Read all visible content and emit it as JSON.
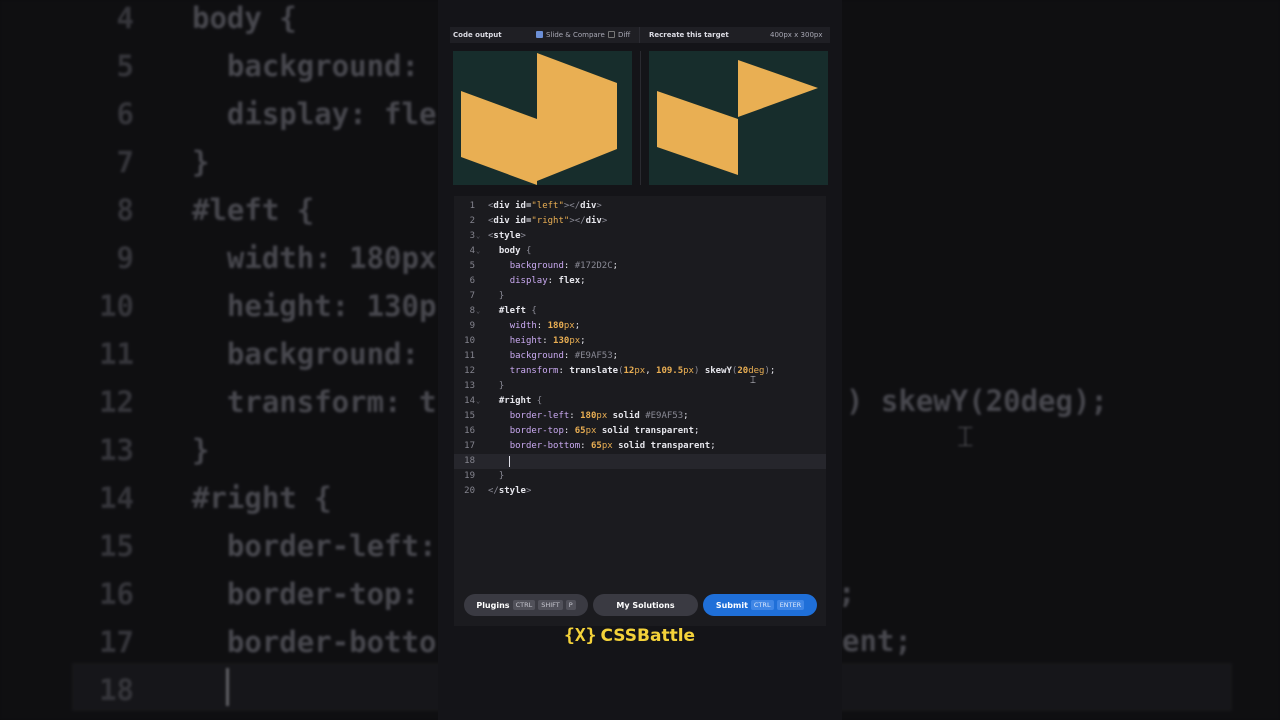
{
  "colors": {
    "accent": "#E9AF53",
    "preview_bg": "#172D2C",
    "submit_blue": "#1f6fd8",
    "logo_yellow": "#f4d23a"
  },
  "toolbar": {
    "code_output": "Code output",
    "slide_compare": "Slide & Compare",
    "slide_compare_checked": true,
    "diff": "Diff",
    "diff_checked": false,
    "recreate": "Recreate this target",
    "size": "400px x 300px"
  },
  "editor": {
    "lines": [
      {
        "n": "1",
        "fold": false,
        "tokens": [
          [
            "br",
            "<"
          ],
          [
            "tag",
            "div"
          ],
          [
            "txt",
            " "
          ],
          [
            "attr",
            "id="
          ],
          [
            "str",
            "\"left\""
          ],
          [
            "br",
            "></"
          ],
          [
            "tag",
            "div"
          ],
          [
            "br",
            ">"
          ]
        ]
      },
      {
        "n": "2",
        "fold": false,
        "tokens": [
          [
            "br",
            "<"
          ],
          [
            "tag",
            "div"
          ],
          [
            "txt",
            " "
          ],
          [
            "attr",
            "id="
          ],
          [
            "str",
            "\"right\""
          ],
          [
            "br",
            "></"
          ],
          [
            "tag",
            "div"
          ],
          [
            "br",
            ">"
          ]
        ]
      },
      {
        "n": "3",
        "fold": true,
        "tokens": [
          [
            "br",
            "<"
          ],
          [
            "tag",
            "style"
          ],
          [
            "br",
            ">"
          ]
        ]
      },
      {
        "n": "4",
        "fold": true,
        "tokens": [
          [
            "txt",
            "  "
          ],
          [
            "sel",
            "body"
          ],
          [
            "txt",
            " "
          ],
          [
            "dim",
            "{"
          ]
        ]
      },
      {
        "n": "5",
        "fold": false,
        "tokens": [
          [
            "txt",
            "    "
          ],
          [
            "prop",
            "background"
          ],
          [
            "txt",
            ": "
          ],
          [
            "dim",
            "#172D2C"
          ],
          [
            "txt",
            ";"
          ]
        ]
      },
      {
        "n": "6",
        "fold": false,
        "tokens": [
          [
            "txt",
            "    "
          ],
          [
            "prop",
            "display"
          ],
          [
            "txt",
            ": "
          ],
          [
            "val",
            "flex"
          ],
          [
            "txt",
            ";"
          ]
        ]
      },
      {
        "n": "7",
        "fold": false,
        "tokens": [
          [
            "txt",
            "  "
          ],
          [
            "dim",
            "}"
          ]
        ]
      },
      {
        "n": "8",
        "fold": true,
        "tokens": [
          [
            "txt",
            "  "
          ],
          [
            "sel",
            "#left"
          ],
          [
            "txt",
            " "
          ],
          [
            "dim",
            "{"
          ]
        ]
      },
      {
        "n": "9",
        "fold": false,
        "tokens": [
          [
            "txt",
            "    "
          ],
          [
            "prop",
            "width"
          ],
          [
            "txt",
            ": "
          ],
          [
            "num",
            "180"
          ],
          [
            "unit",
            "px"
          ],
          [
            "txt",
            ";"
          ]
        ]
      },
      {
        "n": "10",
        "fold": false,
        "tokens": [
          [
            "txt",
            "    "
          ],
          [
            "prop",
            "height"
          ],
          [
            "txt",
            ": "
          ],
          [
            "num",
            "130"
          ],
          [
            "unit",
            "px"
          ],
          [
            "txt",
            ";"
          ]
        ]
      },
      {
        "n": "11",
        "fold": false,
        "tokens": [
          [
            "txt",
            "    "
          ],
          [
            "prop",
            "background"
          ],
          [
            "txt",
            ": "
          ],
          [
            "dim",
            "#E9AF53"
          ],
          [
            "txt",
            ";"
          ]
        ]
      },
      {
        "n": "12",
        "fold": false,
        "tokens": [
          [
            "txt",
            "    "
          ],
          [
            "prop",
            "transform"
          ],
          [
            "txt",
            ": "
          ],
          [
            "val",
            "translate"
          ],
          [
            "dim",
            "("
          ],
          [
            "num",
            "12"
          ],
          [
            "unit",
            "px"
          ],
          [
            "txt",
            ", "
          ],
          [
            "num",
            "109.5"
          ],
          [
            "unit",
            "px"
          ],
          [
            "dim",
            ")"
          ],
          [
            "txt",
            " "
          ],
          [
            "val",
            "skewY"
          ],
          [
            "dim",
            "("
          ],
          [
            "num",
            "20"
          ],
          [
            "unit",
            "deg"
          ],
          [
            "dim",
            ")"
          ],
          [
            "txt",
            ";"
          ]
        ]
      },
      {
        "n": "13",
        "fold": false,
        "tokens": [
          [
            "txt",
            "  "
          ],
          [
            "dim",
            "}"
          ]
        ]
      },
      {
        "n": "14",
        "fold": true,
        "tokens": [
          [
            "txt",
            "  "
          ],
          [
            "sel",
            "#right"
          ],
          [
            "txt",
            " "
          ],
          [
            "dim",
            "{"
          ]
        ]
      },
      {
        "n": "15",
        "fold": false,
        "tokens": [
          [
            "txt",
            "    "
          ],
          [
            "prop",
            "border-left"
          ],
          [
            "txt",
            ": "
          ],
          [
            "num",
            "180"
          ],
          [
            "unit",
            "px"
          ],
          [
            "txt",
            " "
          ],
          [
            "val",
            "solid"
          ],
          [
            "txt",
            " "
          ],
          [
            "dim",
            "#E9AF53"
          ],
          [
            "txt",
            ";"
          ]
        ]
      },
      {
        "n": "16",
        "fold": false,
        "tokens": [
          [
            "txt",
            "    "
          ],
          [
            "prop",
            "border-top"
          ],
          [
            "txt",
            ": "
          ],
          [
            "num",
            "65"
          ],
          [
            "unit",
            "px"
          ],
          [
            "txt",
            " "
          ],
          [
            "val",
            "solid"
          ],
          [
            "txt",
            " "
          ],
          [
            "val",
            "transparent"
          ],
          [
            "txt",
            ";"
          ]
        ]
      },
      {
        "n": "17",
        "fold": false,
        "tokens": [
          [
            "txt",
            "    "
          ],
          [
            "prop",
            "border-bottom"
          ],
          [
            "txt",
            ": "
          ],
          [
            "num",
            "65"
          ],
          [
            "unit",
            "px"
          ],
          [
            "txt",
            " "
          ],
          [
            "val",
            "solid"
          ],
          [
            "txt",
            " "
          ],
          [
            "val",
            "transparent"
          ],
          [
            "txt",
            ";"
          ]
        ]
      },
      {
        "n": "18",
        "fold": false,
        "active": true,
        "tokens": []
      },
      {
        "n": "19",
        "fold": false,
        "tokens": [
          [
            "txt",
            "  "
          ],
          [
            "dim",
            "}"
          ]
        ]
      },
      {
        "n": "20",
        "fold": false,
        "tokens": [
          [
            "br",
            "</"
          ],
          [
            "tag",
            "style"
          ],
          [
            "br",
            ">"
          ]
        ]
      }
    ]
  },
  "background_zoom": {
    "lines": [
      {
        "n": "4",
        "text": "body {"
      },
      {
        "n": "5",
        "text": "  background:"
      },
      {
        "n": "6",
        "text": "  display: fle"
      },
      {
        "n": "7",
        "text": "}"
      },
      {
        "n": "8",
        "text": "#left {"
      },
      {
        "n": "9",
        "text": "  width: 180px"
      },
      {
        "n": "10",
        "text": "  height: 130p"
      },
      {
        "n": "11",
        "text": "  background:"
      },
      {
        "n": "12",
        "text": "  transform: t"
      },
      {
        "n": "13",
        "text": "}"
      },
      {
        "n": "14",
        "text": "#right {"
      },
      {
        "n": "15",
        "text": "  border-left:"
      },
      {
        "n": "16",
        "text": "  border-top:"
      },
      {
        "n": "17",
        "text": "  border-botto"
      },
      {
        "n": "18",
        "text": ""
      }
    ],
    "right_fragments": [
      ") skewY(20deg);",
      ";",
      "ent;"
    ]
  },
  "buttons": {
    "plugins": {
      "label": "Plugins",
      "keys": [
        "CTRL",
        "SHIFT",
        "P"
      ]
    },
    "solutions": {
      "label": "My Solutions"
    },
    "submit": {
      "label": "Submit",
      "keys": [
        "CTRL",
        "ENTER"
      ]
    }
  },
  "logo": {
    "mark": "{X}",
    "text": "CSSBattle"
  }
}
